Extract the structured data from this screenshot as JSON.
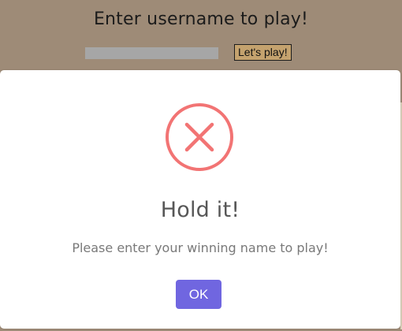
{
  "page": {
    "title": "Enter username to play!",
    "username_input": {
      "value": "",
      "placeholder": ""
    },
    "play_button_label": "Let's play!"
  },
  "modal": {
    "icon": "error-x-icon",
    "title": "Hold it!",
    "message": "Please enter your winning name to play!",
    "ok_label": "OK"
  },
  "colors": {
    "background": "#9e8b77",
    "play_button": "#c4a26e",
    "error_icon": "#f27474",
    "ok_button": "#7066e0",
    "modal_bg": "#ffffff"
  }
}
